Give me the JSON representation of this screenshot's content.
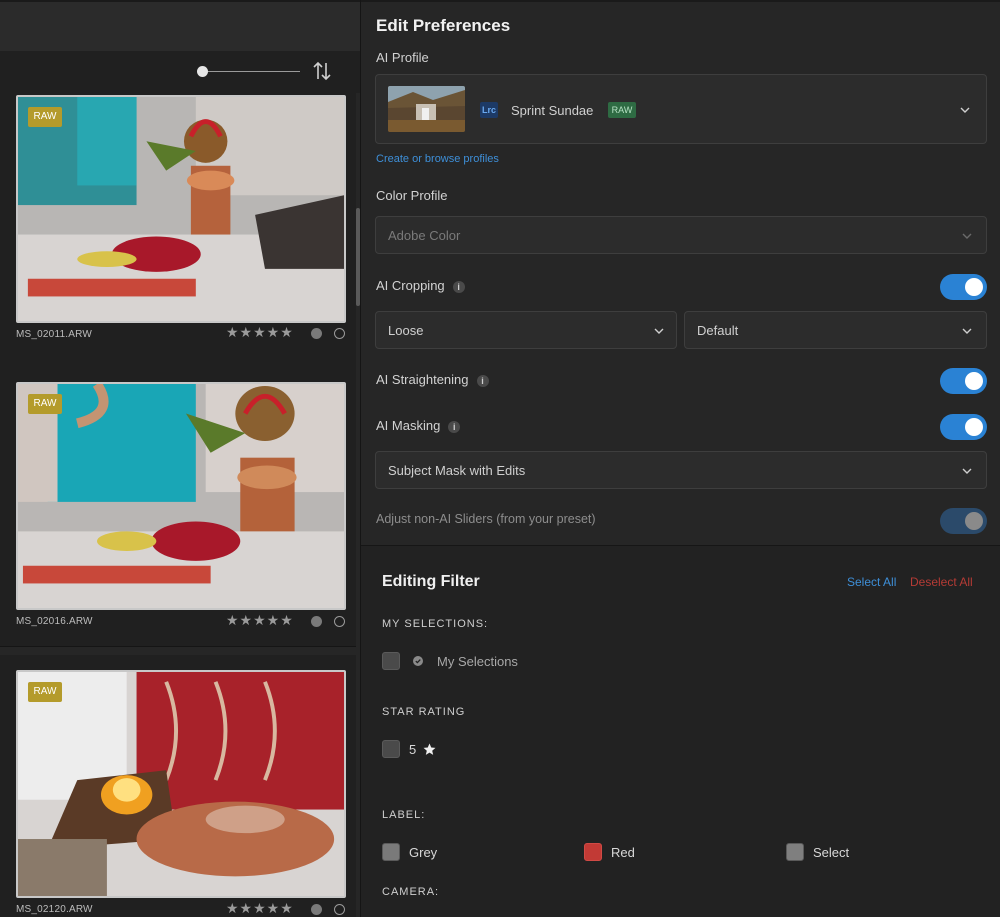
{
  "photos": [
    {
      "file": "MS_02011.ARW",
      "badge": "RAW",
      "stars": "★★★★★"
    },
    {
      "file": "MS_02016.ARW",
      "badge": "RAW",
      "stars": "★★★★★"
    },
    {
      "file": "MS_02120.ARW",
      "badge": "RAW",
      "stars": "★★★★★"
    }
  ],
  "prefs": {
    "title": "Edit Preferences",
    "ai_profile_label": "AI Profile",
    "profile_app_badge": "Lrc",
    "profile_name": "Sprint Sundae",
    "profile_raw_badge": "RAW",
    "profile_link": "Create or browse profiles",
    "color_profile_label": "Color Profile",
    "color_profile_placeholder": "Adobe Color",
    "cropping_label": "AI Cropping",
    "cropping_mode": "Loose",
    "cropping_ratio": "Default",
    "straightening_label": "AI Straightening",
    "masking_label": "AI Masking",
    "masking_mode": "Subject Mask with Edits",
    "non_ai_label": "Adjust non-AI Sliders (from your preset)",
    "info_glyph": "i"
  },
  "filter": {
    "title": "Editing Filter",
    "select_all": "Select All",
    "deselect_all": "Deselect All",
    "my_selections_heading": "MY SELECTIONS:",
    "my_selections_item": "My Selections",
    "star_heading": "STAR RATING",
    "star_value": "5",
    "label_heading": "LABEL:",
    "labels": [
      "Grey",
      "Red",
      "Select"
    ],
    "camera_heading": "CAMERA:"
  },
  "colors": {
    "accent": "#2a82d4",
    "link": "#3e8fd8",
    "danger": "#b53b35",
    "raw_badge": "#b49b2b"
  }
}
